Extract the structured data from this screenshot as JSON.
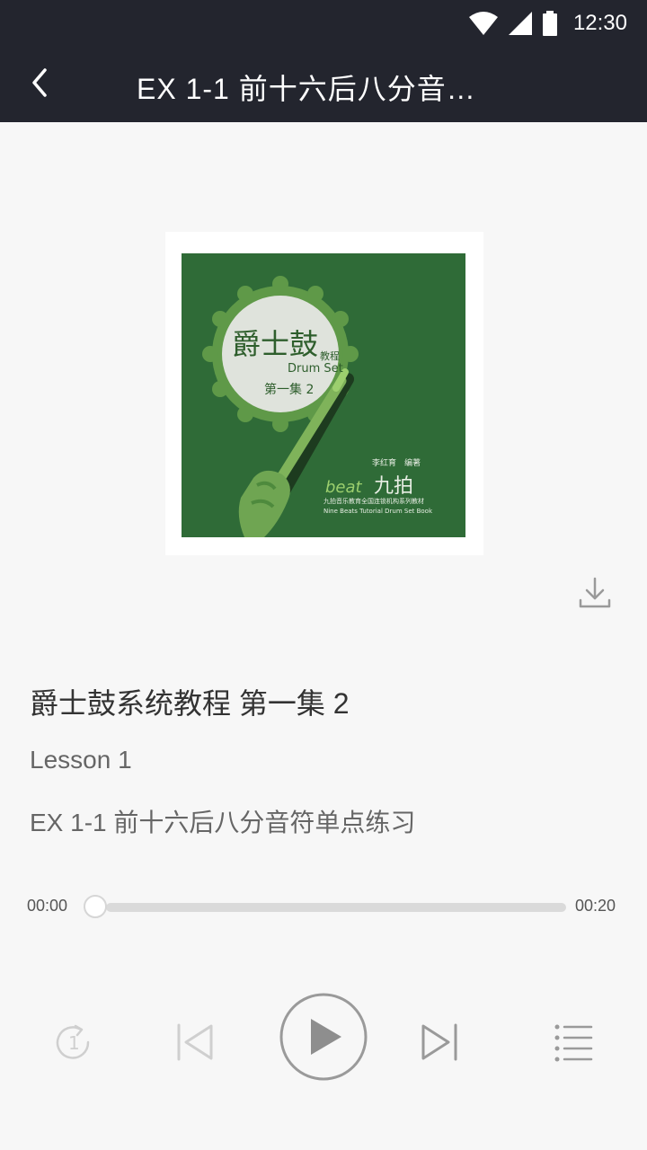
{
  "status_bar": {
    "time": "12:30"
  },
  "header": {
    "title": "EX 1-1 前十六后八分音…"
  },
  "cover": {
    "title_main": "爵士鼓",
    "title_small": "教程",
    "title_en": "Drum Set",
    "volume": "第一集 2",
    "author": "李红育　编著",
    "brand_en": "beat",
    "brand_cn": "九拍",
    "series_cn": "九拍音乐教育全国连锁机构系列教材",
    "series_en": "Nine Beats Tutorial Drum Set Book",
    "colors": {
      "background": "#2f6b37",
      "accent": "#7fb35a"
    }
  },
  "track": {
    "album_title": "爵士鼓系统教程 第一集 2",
    "lesson": "Lesson 1",
    "name": "EX 1-1 前十六后八分音符单点练习"
  },
  "player": {
    "current_time": "00:00",
    "total_time": "00:20",
    "progress": 0,
    "repeat_count": "1"
  },
  "icons": {
    "back": "chevron-left-icon",
    "download": "download-icon",
    "repeat": "repeat-one-icon",
    "previous": "skip-previous-icon",
    "play": "play-icon",
    "next": "skip-next-icon",
    "playlist": "playlist-icon"
  }
}
